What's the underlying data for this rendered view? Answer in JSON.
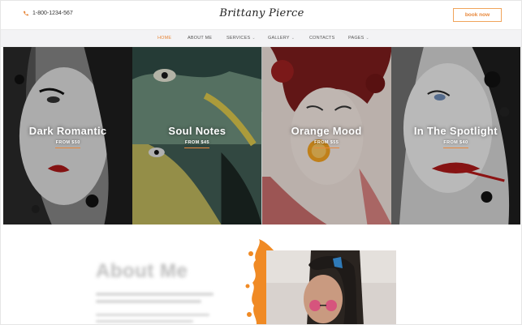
{
  "header": {
    "phone": "1-800-1234-567",
    "phone_icon": "phone-icon",
    "logo": "Brittany Pierce",
    "book_button": "book now"
  },
  "nav": {
    "items": [
      {
        "label": "HOME",
        "active": true
      },
      {
        "label": "ABOUT ME"
      },
      {
        "label": "SERVICES",
        "dropdown": true
      },
      {
        "label": "GALLERY",
        "dropdown": true
      },
      {
        "label": "CONTACTS"
      },
      {
        "label": "PAGES",
        "dropdown": true
      }
    ]
  },
  "gallery": {
    "tiles": [
      {
        "title": "Dark Romantic",
        "price": "FROM $50"
      },
      {
        "title": "Soul Notes",
        "price": "FROM $45"
      },
      {
        "title": "Orange Mood",
        "price": "FROM $55"
      },
      {
        "title": "In The Spotlight",
        "price": "FROM $40"
      }
    ]
  },
  "about": {
    "title": "About Me"
  },
  "colors": {
    "accent": "#e8873a",
    "nav_bg": "#f3f3f5"
  }
}
